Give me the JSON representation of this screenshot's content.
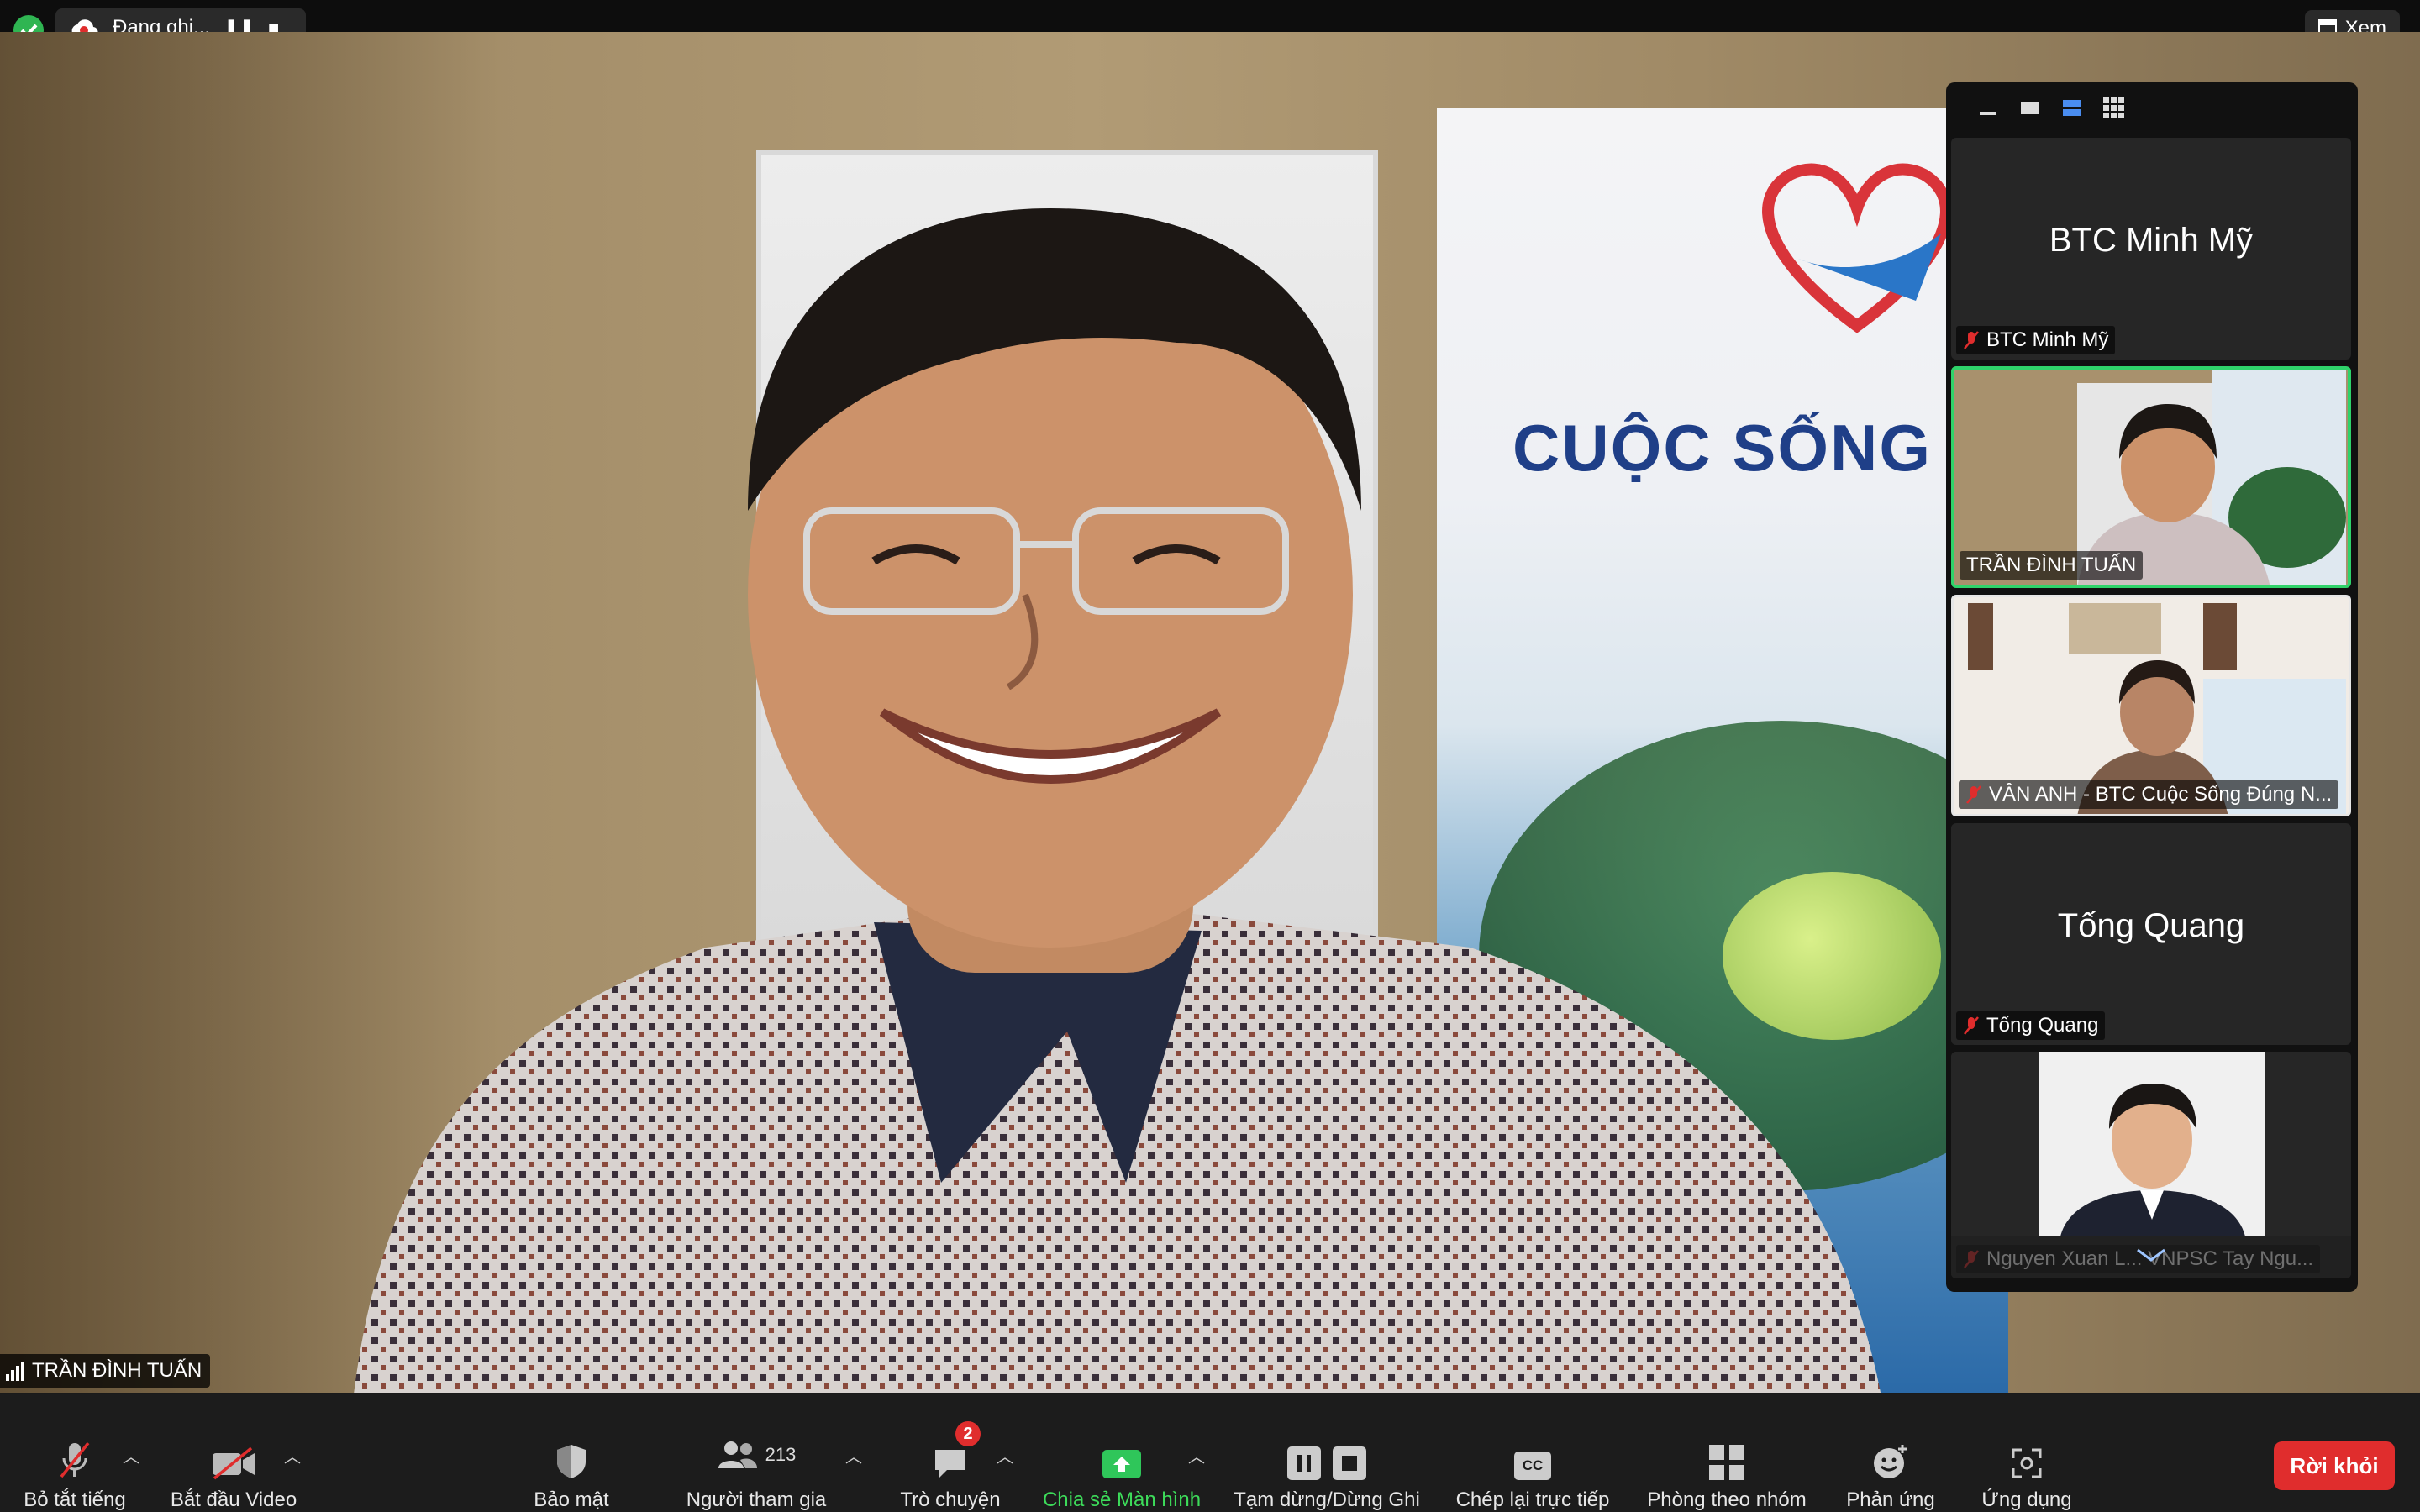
{
  "topbar": {
    "recording_label": "Đang ghi...",
    "view_label": "Xem"
  },
  "main_video": {
    "speaker_name": "TRẦN ĐÌNH TUẤN",
    "banner_text": "CUỘC SỐNG ĐÚ"
  },
  "gallery": {
    "tiles": [
      {
        "display_name": "BTC Minh Mỹ",
        "label": "BTC Minh Mỹ"
      },
      {
        "label": "TRẦN ĐÌNH TUẤN"
      },
      {
        "label": "VÂN ANH - BTC Cuộc Sống Đúng N..."
      },
      {
        "display_name": "Tống Quang",
        "label": "Tống Quang"
      },
      {
        "label": "Nguyen Xuan L... VNPSC Tay Ngu..."
      }
    ]
  },
  "toolbar": {
    "mute_label": "Bỏ tắt tiếng",
    "video_label": "Bắt đầu Video",
    "security_label": "Bảo mật",
    "participants_label": "Người tham gia",
    "participants_count": "213",
    "chat_label": "Trò chuyện",
    "chat_badge": "2",
    "share_label": "Chia sẻ Màn hình",
    "record_label": "Tạm dừng/Dừng Ghi",
    "captions_label": "Chép lại trực tiếp",
    "captions_icon_text": "CC",
    "breakout_label": "Phòng theo nhóm",
    "reactions_label": "Phản ứng",
    "apps_label": "Ứng dụng",
    "leave_label": "Rời khỏi"
  },
  "colors": {
    "accent_green": "#3ddc5a",
    "leave_red": "#e02d2d",
    "banner_blue": "#1f3f88"
  }
}
